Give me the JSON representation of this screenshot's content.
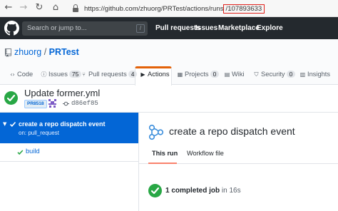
{
  "browser": {
    "url_prefix": "https://github.com/zhuorg/PRTest/actions/runs",
    "url_run_id": "/107893633",
    "nav_icons": [
      "back-icon",
      "forward-icon",
      "refresh-icon",
      "home-icon"
    ]
  },
  "github_header": {
    "search_placeholder": "Search or jump to...",
    "search_shortcut": "/",
    "nav": [
      "Pull requests",
      "Issues",
      "Marketplace",
      "Explore"
    ]
  },
  "repo": {
    "owner": "zhuorg",
    "separator": " / ",
    "name": "PRTest"
  },
  "tabs": [
    {
      "label": "Code",
      "icon": "code-icon"
    },
    {
      "label": "Issues",
      "count": "75",
      "icon": "issue-icon"
    },
    {
      "label": "Pull requests",
      "count": "4",
      "icon": "pull-request-icon"
    },
    {
      "label": "Actions",
      "icon": "play-icon",
      "selected": true
    },
    {
      "label": "Projects",
      "count": "0",
      "icon": "project-icon"
    },
    {
      "label": "Wiki",
      "icon": "book-icon"
    },
    {
      "label": "Security",
      "count": "0",
      "icon": "shield-icon"
    },
    {
      "label": "Insights",
      "icon": "graph-icon"
    }
  ],
  "run": {
    "title": "Update former.yml",
    "pr_tag": "PR8518",
    "sha": "d86ef85"
  },
  "sidebar": {
    "workflow_name": "create a repo dispatch event",
    "workflow_trigger": "on: pull_request",
    "job": "build"
  },
  "main": {
    "title": "create a repo dispatch event",
    "subtabs": [
      "This run",
      "Workflow file"
    ],
    "job_summary_bold": "1 completed job",
    "job_summary_rest": " in 16s"
  },
  "colors": {
    "accent": "#0366d6",
    "success": "#28a745",
    "header_bg": "#24292e",
    "tab_underline": "#e36209",
    "url_highlight": "#e0201b"
  }
}
